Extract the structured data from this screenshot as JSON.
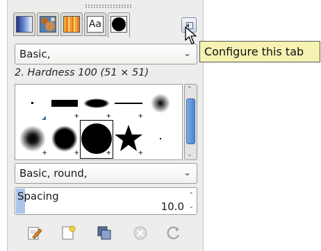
{
  "tabs": [
    {
      "name": "gradient",
      "icon": "gradient-icon"
    },
    {
      "name": "patterns",
      "icon": "pattern-icon"
    },
    {
      "name": "palette",
      "icon": "palette-icon"
    },
    {
      "name": "fonts",
      "icon": "font-icon",
      "label": "Aa"
    },
    {
      "name": "brushes",
      "icon": "brush-icon",
      "active": true
    }
  ],
  "configure_tooltip": "Configure this tab",
  "brush_tag_filter": "Basic,",
  "brush_title": "2. Hardness 100 (51 × 51)",
  "brush_tags_entry": "Basic, round,",
  "spacing": {
    "label": "Spacing",
    "value": "10.0",
    "fraction": 0.05
  },
  "footer_buttons": [
    "edit-brush",
    "new-brush",
    "duplicate-brush",
    "delete-brush",
    "refresh-brushes"
  ],
  "colors": {
    "accent": "#4d85d0",
    "tooltip_bg": "#f6f2b2",
    "panel_bg": "#ededeb"
  }
}
